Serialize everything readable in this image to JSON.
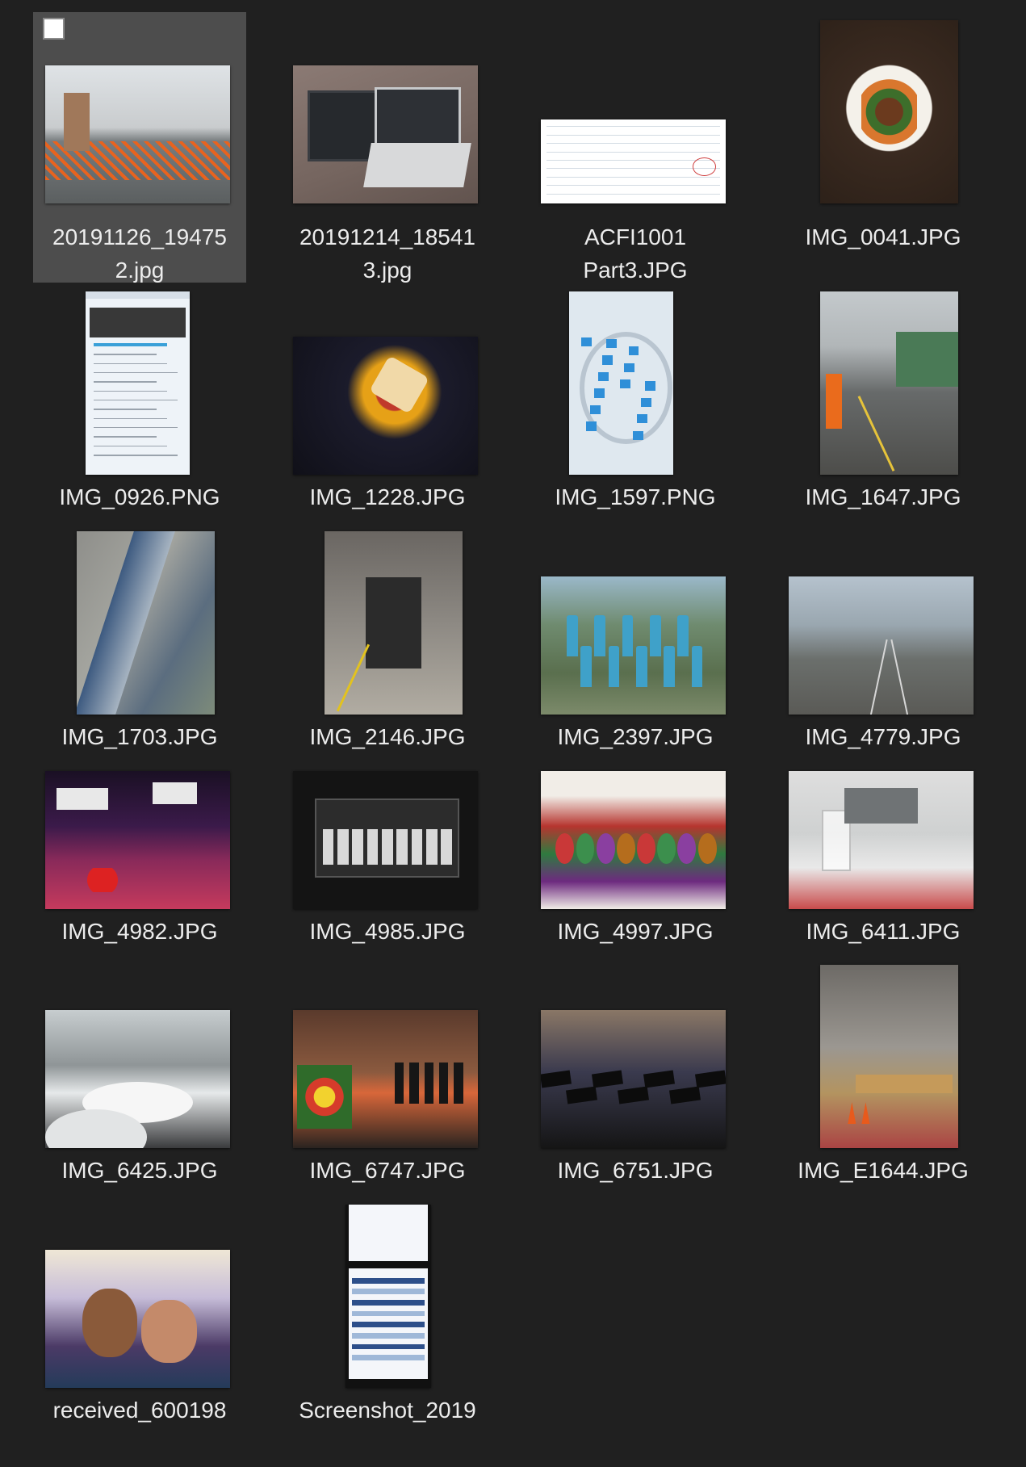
{
  "window": {
    "background": "#202020",
    "selection_color": "#4d4d4d"
  },
  "files": [
    {
      "name_lines": [
        "20191126_19475",
        "2.jpg"
      ],
      "selected": true,
      "checkbox": true,
      "thumb_icon": "photo-room-fence-icon"
    },
    {
      "name_lines": [
        "20191214_18541",
        "3.jpg"
      ],
      "thumb_icon": "photo-laptops-icon"
    },
    {
      "name_lines": [
        "ACFI1001",
        "Part3.JPG"
      ],
      "thumb_icon": "document-scan-icon"
    },
    {
      "name_lines": [
        "IMG_0041.JPG"
      ],
      "thumb_icon": "photo-food-plate-icon"
    },
    {
      "name_lines": [
        "IMG_0926.PNG"
      ],
      "thumb_icon": "screenshot-email-icon"
    },
    {
      "name_lines": [
        "IMG_1228.JPG"
      ],
      "thumb_icon": "photo-snacks-icon"
    },
    {
      "name_lines": [
        "IMG_1597.PNG"
      ],
      "thumb_icon": "screenshot-map-icon"
    },
    {
      "name_lines": [
        "IMG_1647.JPG"
      ],
      "thumb_icon": "photo-rail-yard-icon"
    },
    {
      "name_lines": [
        "IMG_1703.JPG"
      ],
      "thumb_icon": "photo-railing-icon"
    },
    {
      "name_lines": [
        "IMG_2146.JPG"
      ],
      "thumb_icon": "photo-train-depot-icon"
    },
    {
      "name_lines": [
        "IMG_2397.JPG"
      ],
      "thumb_icon": "photo-group-icon"
    },
    {
      "name_lines": [
        "IMG_4779.JPG"
      ],
      "thumb_icon": "photo-railway-track-icon"
    },
    {
      "name_lines": [
        "IMG_4982.JPG"
      ],
      "thumb_icon": "photo-bowling-alley-icon"
    },
    {
      "name_lines": [
        "IMG_4985.JPG"
      ],
      "thumb_icon": "photo-scoreboard-icon"
    },
    {
      "name_lines": [
        "IMG_4997.JPG"
      ],
      "thumb_icon": "photo-chocolates-icon"
    },
    {
      "name_lines": [
        "IMG_6411.JPG"
      ],
      "thumb_icon": "photo-conference-table-icon"
    },
    {
      "name_lines": [
        "IMG_6425.JPG"
      ],
      "thumb_icon": "photo-function-room-icon"
    },
    {
      "name_lines": [
        "IMG_6747.JPG"
      ],
      "thumb_icon": "photo-graduation-stage-icon"
    },
    {
      "name_lines": [
        "IMG_6751.JPG"
      ],
      "thumb_icon": "photo-graduates-icon"
    },
    {
      "name_lines": [
        "IMG_E1644.JPG"
      ],
      "thumb_icon": "photo-workshop-icon"
    },
    {
      "name_lines": [
        "received_600198"
      ],
      "thumb_icon": "photo-selfie-icon"
    },
    {
      "name_lines": [
        "Screenshot_2019"
      ],
      "thumb_icon": "screenshot-timetable-icon"
    }
  ]
}
